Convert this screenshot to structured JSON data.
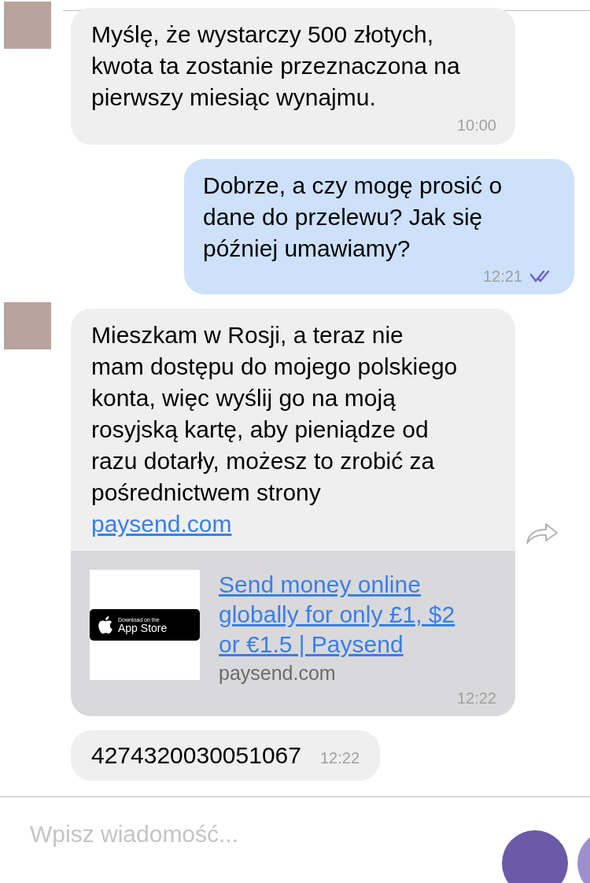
{
  "messages": [
    {
      "kind": "incoming",
      "avatar": true,
      "text": "Myślę, że wystarczy 500 złotych, kwota ta zostanie przeznaczona na pierwszy miesiąc wynajmu.",
      "time": "10:00"
    },
    {
      "kind": "outgoing",
      "text": "Dobrze, a czy mogę prosić o dane do przelewu? Jak się później umawiamy?",
      "time": "12:21",
      "read": true
    },
    {
      "kind": "incoming",
      "avatar": true,
      "forward": true,
      "text": "Mieszkam w Rosji, a teraz nie mam dostępu do mojego polskiego konta, więc wyślij go na moją rosyjską kartę, aby pieniądze od razu dotarły, możesz to zrobić za pośrednictwem strony",
      "link": "paysend.com",
      "preview": {
        "badge_small": "Download on the",
        "badge_large": "App Store",
        "title": "Send money online globally for only £1, $2 or €1.5 | Paysend",
        "domain": "paysend.com"
      },
      "time": "12:22"
    },
    {
      "kind": "inline",
      "text": "4274320030051067",
      "time": "12:22"
    }
  ],
  "composer": {
    "placeholder": "Wpisz wiadomość..."
  }
}
